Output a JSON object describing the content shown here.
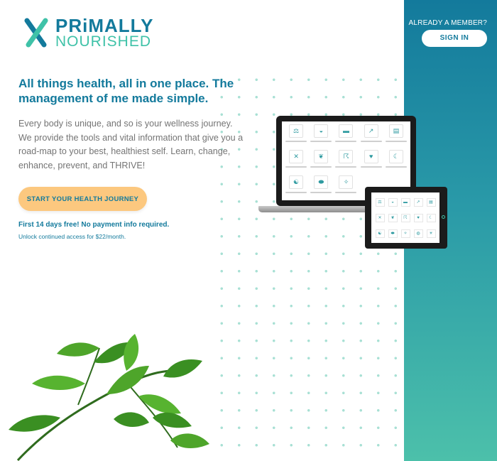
{
  "brand": {
    "name_line1": "PRiMALLY",
    "name_line2": "NOURISHED",
    "colors": {
      "primary": "#137a9c",
      "accent": "#3fc2a8",
      "cta": "#fcc87f",
      "body_text": "#747474"
    }
  },
  "header": {
    "member_prompt": "ALREADY A MEMBER?",
    "signin_label": "SIGN IN"
  },
  "hero": {
    "headline": "All things health, all in one place. The management of me made simple.",
    "body": "Every body is unique, and so is your wellness journey. We provide the tools and vital information that give you a road-map to your best, healthiest self. Learn, change, enhance, prevent, and THRIVE!",
    "cta_label": "START YOUR HEALTH JOURNEY",
    "trial_note": "First 14 days free! No payment info required.",
    "price_note": "Unlock continued access for $22/month."
  },
  "devices": {
    "laptop_icons": [
      "scale-icon",
      "bowl-icon",
      "dumbbell-icon",
      "chart-icon",
      "book-icon",
      "utensils-icon",
      "leaf-icon",
      "runner-icon",
      "heart-icon",
      "sleep-icon",
      "meditate-icon",
      "pill-icon",
      "stretch-icon"
    ],
    "tablet_icons": [
      "scale-icon",
      "bowl-icon",
      "dumbbell-icon",
      "chart-icon",
      "book-icon",
      "utensils-icon",
      "leaf-icon",
      "runner-icon",
      "heart-icon",
      "sleep-icon",
      "meditate-icon",
      "pill-icon",
      "stretch-icon",
      "water-icon",
      "sun-icon"
    ]
  },
  "decor": {
    "plant": "leaf-branch-illustration"
  }
}
